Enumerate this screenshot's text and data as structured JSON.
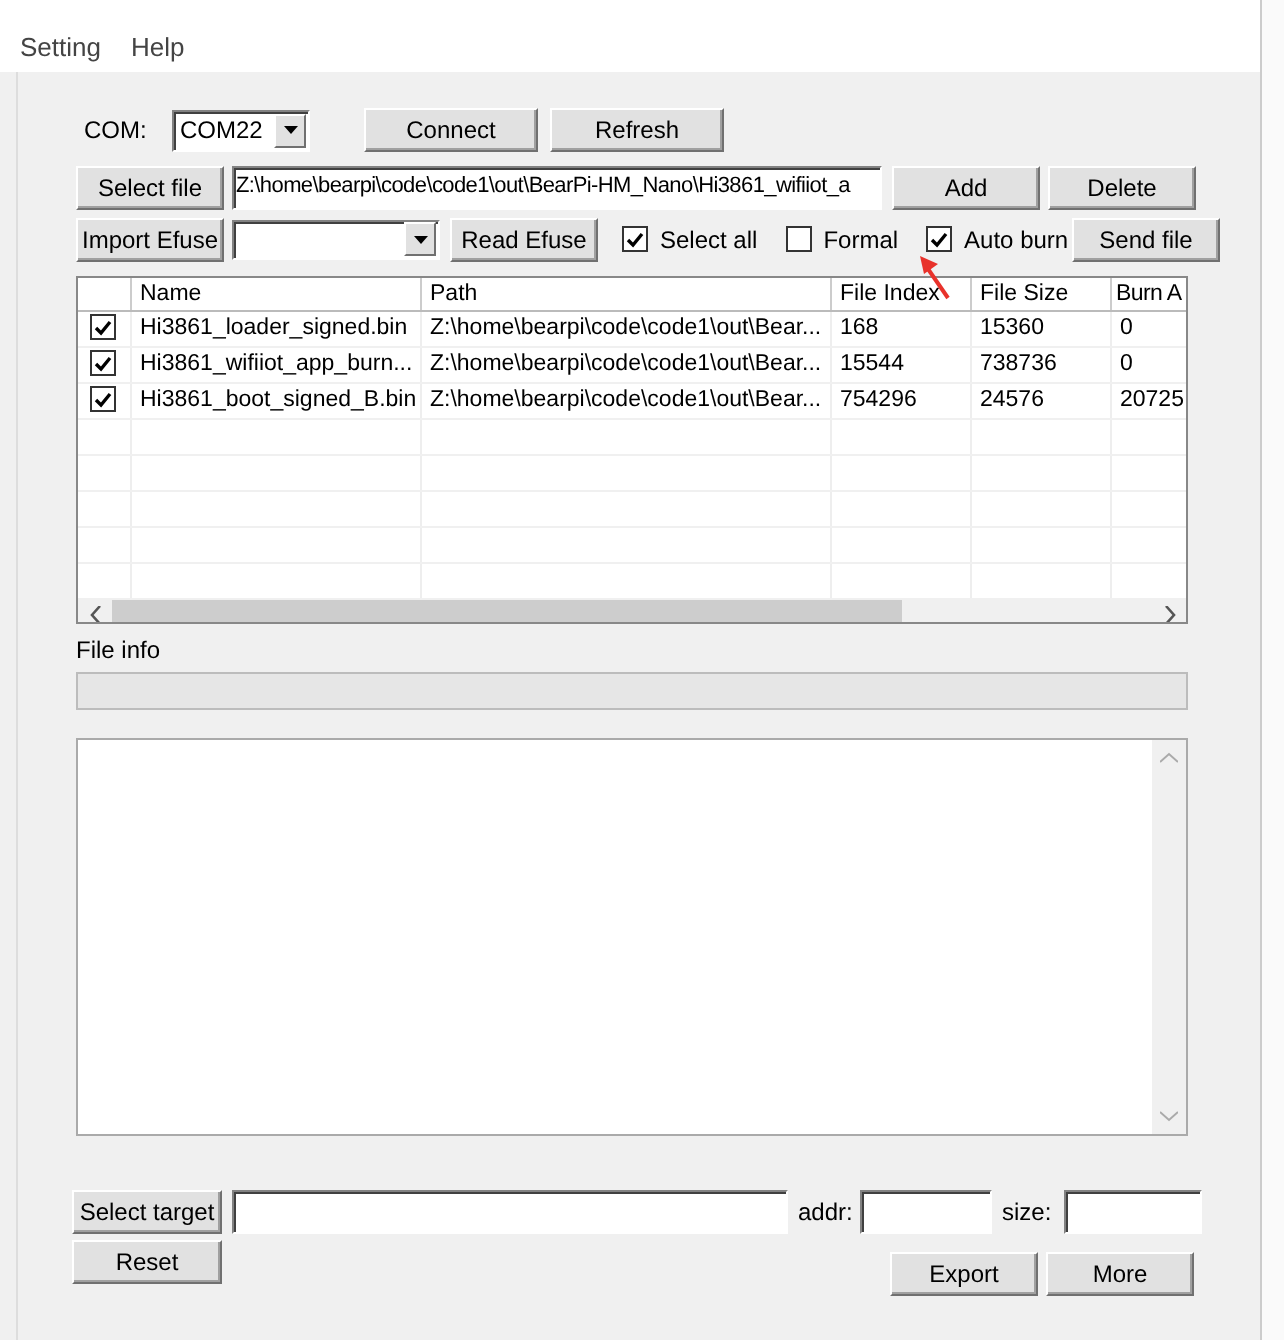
{
  "menu": [
    {
      "label": "Setting"
    },
    {
      "label": "Help"
    }
  ],
  "com": {
    "label": "COM:",
    "value": "COM22",
    "buttons": [
      "Connect",
      "Refresh"
    ]
  },
  "file_row": {
    "button": "Select file",
    "path": "Z:\\home\\bearpi\\code\\code1\\out\\BearPi-HM_Nano\\Hi3861_wifiiot_a",
    "actions": [
      "Add",
      "Delete"
    ]
  },
  "efuse_row": {
    "import_button": "Import Efuse",
    "read_button": "Read Efuse",
    "send_button": "Send file"
  },
  "options": [
    {
      "label": "Select all",
      "checked": true
    },
    {
      "label": "Formal",
      "checked": false
    },
    {
      "label": "Auto burn",
      "checked": true
    }
  ],
  "table": {
    "columns": [
      "Name",
      "Path",
      "File Index",
      "File Size",
      "Burn A"
    ],
    "rows": [
      {
        "checked": true,
        "cells": [
          "Hi3861_loader_signed.bin",
          "Z:\\home\\bearpi\\code\\code1\\out\\Bear...",
          "168",
          "15360",
          "0"
        ]
      },
      {
        "checked": true,
        "cells": [
          "Hi3861_wifiiot_app_burn...",
          "Z:\\home\\bearpi\\code\\code1\\out\\Bear...",
          "15544",
          "738736",
          "0"
        ]
      },
      {
        "checked": true,
        "cells": [
          "Hi3861_boot_signed_B.bin",
          "Z:\\home\\bearpi\\code\\code1\\out\\Bear...",
          "754296",
          "24576",
          "20725"
        ]
      }
    ]
  },
  "file_info": {
    "label": "File info",
    "level": 0
  },
  "target": {
    "button": "Select target",
    "addr_label": "addr:",
    "size_label": "size:"
  },
  "bottom_buttons": {
    "reset": "Reset",
    "export": "Export",
    "more": "More"
  }
}
